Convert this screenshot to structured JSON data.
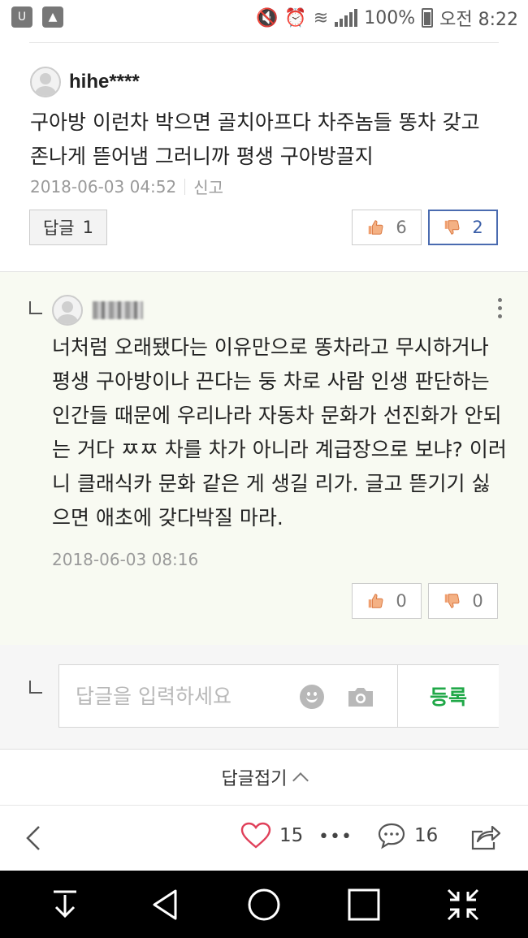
{
  "status_bar": {
    "battery": "100%",
    "time": "오전 8:22"
  },
  "comment": {
    "username": "hihe****",
    "text": "구아방 이런차 박으면 골치아프다 차주놈들 똥차 갖고 존나게 뜯어냄 그러니까 평생 구아방끌지",
    "date": "2018-06-03 04:52",
    "report_label": "신고",
    "reply_label": "답글",
    "reply_count": "1",
    "likes": "6",
    "dislikes": "2"
  },
  "reply": {
    "text": "너처럼 오래됐다는 이유만으로 똥차라고 무시하거나 평생 구아방이나 끈다는 둥 차로 사람 인생 판단하는 인간들 때문에 우리나라 자동차 문화가 선진화가 안되는 거다 ㅉㅉ 차를 차가 아니라 계급장으로 보냐? 이러니 클래식카 문화 같은 게 생길 리가. 글고 뜯기기 싫으면 애초에 갖다박질 마라.",
    "date": "2018-06-03 08:16",
    "likes": "0",
    "dislikes": "0"
  },
  "reply_input": {
    "placeholder": "답글을 입력하세요",
    "submit_label": "등록"
  },
  "collapse_label": "답글접기",
  "toolbar": {
    "like_count": "15",
    "more_label": "•••",
    "comment_count": "16"
  },
  "colors": {
    "accent_green": "#20a848",
    "active_blue": "#3b5fa8",
    "heart_red": "#e0405a",
    "reply_bg": "#f8faf2"
  }
}
